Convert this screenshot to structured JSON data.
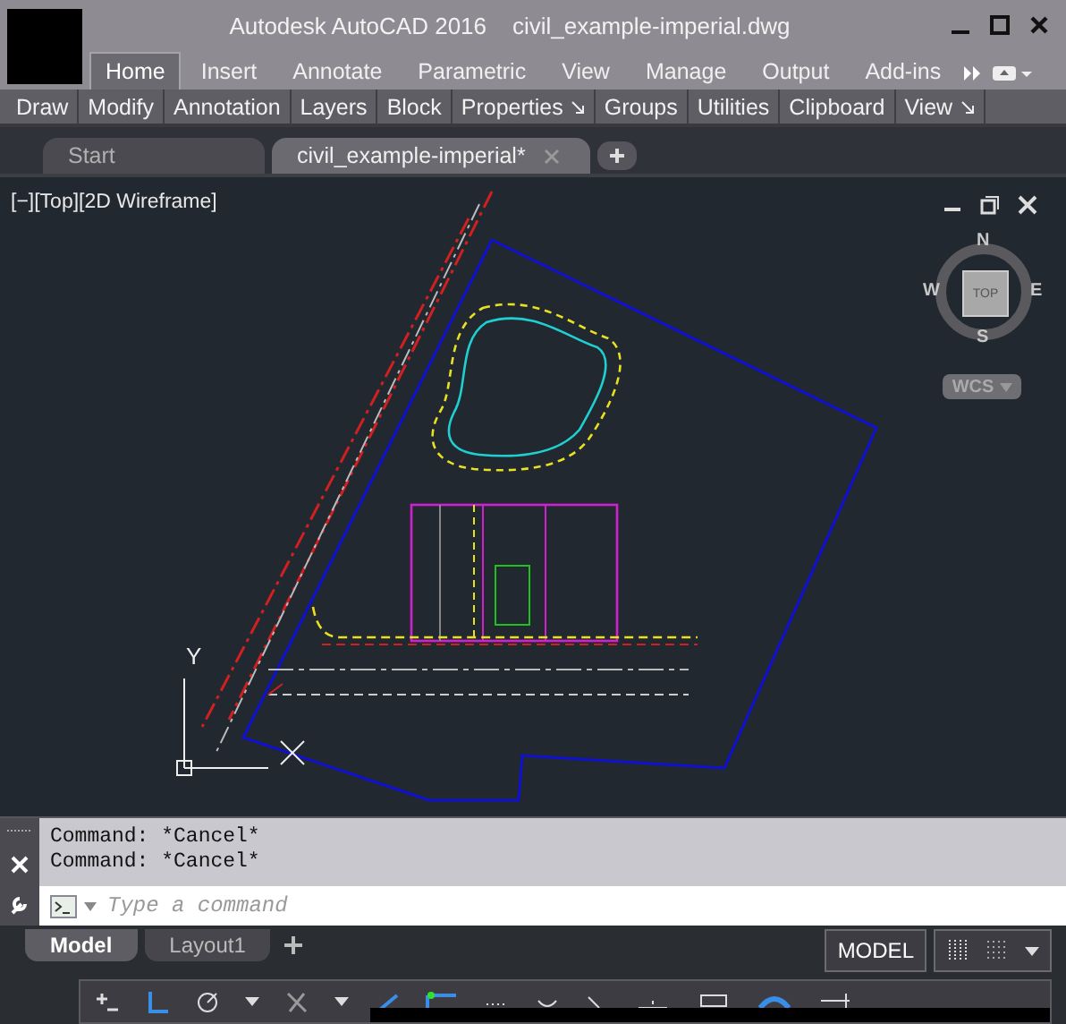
{
  "window": {
    "title": "Autodesk AutoCAD 2016    civil_example-imperial.dwg"
  },
  "ribbon_tabs": [
    {
      "label": "Home",
      "selected": true
    },
    {
      "label": "Insert",
      "selected": false
    },
    {
      "label": "Annotate",
      "selected": false
    },
    {
      "label": "Parametric",
      "selected": false
    },
    {
      "label": "View",
      "selected": false
    },
    {
      "label": "Manage",
      "selected": false
    },
    {
      "label": "Output",
      "selected": false
    },
    {
      "label": "Add-ins",
      "selected": false
    }
  ],
  "ribbon_panels": [
    {
      "label": "Draw",
      "launcher": false
    },
    {
      "label": "Modify",
      "launcher": false
    },
    {
      "label": "Annotation",
      "launcher": false
    },
    {
      "label": "Layers",
      "launcher": false
    },
    {
      "label": "Block",
      "launcher": false
    },
    {
      "label": "Properties",
      "launcher": true
    },
    {
      "label": "Groups",
      "launcher": false
    },
    {
      "label": "Utilities",
      "launcher": false
    },
    {
      "label": "Clipboard",
      "launcher": false
    },
    {
      "label": "View",
      "launcher": true
    }
  ],
  "doc_tabs": [
    {
      "label": "Start",
      "selected": false
    },
    {
      "label": "civil_example-imperial*",
      "selected": true
    }
  ],
  "viewport": {
    "label": "[−][Top][2D Wireframe]",
    "compass": {
      "north": "N",
      "south": "S",
      "east": "E",
      "west": "W",
      "cube": "TOP"
    },
    "ucs_button": "WCS",
    "y_axis": "Y"
  },
  "command": {
    "history": [
      "Command: *Cancel*",
      "Command: *Cancel*"
    ],
    "placeholder": "Type a command"
  },
  "layout_tabs": [
    {
      "label": "Model",
      "selected": true
    },
    {
      "label": "Layout1",
      "selected": false
    }
  ],
  "status_bar": {
    "space": "MODEL"
  }
}
